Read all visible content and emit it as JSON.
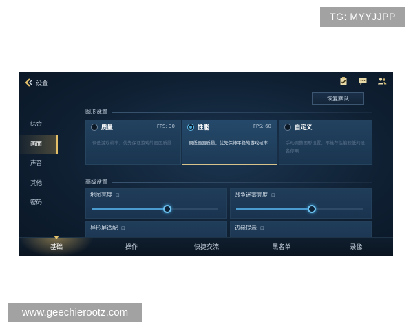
{
  "watermarks": {
    "tag": "TG: MYYJJPP",
    "url": "www.geechierootz.com"
  },
  "header": {
    "title": "设置",
    "restore_label": "恢复默认",
    "icons": [
      "back-arrow-icon",
      "clipboard-check-icon",
      "chat-icon",
      "friends-icon"
    ]
  },
  "sidebar": {
    "items": [
      {
        "label": "综合",
        "active": false
      },
      {
        "label": "画面",
        "active": true
      },
      {
        "label": "声音",
        "active": false
      },
      {
        "label": "其他",
        "active": false
      },
      {
        "label": "密码",
        "active": false
      }
    ]
  },
  "graphics": {
    "section_title": "图形设置",
    "modes": [
      {
        "name": "质量",
        "fps": "FPS: 30",
        "desc": "调低游戏帧率，优先保证游戏的画面质量",
        "selected": false
      },
      {
        "name": "性能",
        "fps": "FPS: 60",
        "desc": "调低画面质量，优先保持平稳的游戏帧率",
        "selected": true
      },
      {
        "name": "自定义",
        "fps": "",
        "desc": "手动调整图形设置，不推荐性能较低的设备使用",
        "selected": false
      }
    ]
  },
  "advanced": {
    "section_title": "高级设置",
    "info_glyph": "⊟",
    "items": [
      {
        "label": "地图亮度",
        "value": 0.6
      },
      {
        "label": "战争迷雾亮度",
        "value": 0.6
      },
      {
        "label": "异形屏适配"
      },
      {
        "label": "边缘提示"
      }
    ]
  },
  "bottom_tabs": [
    {
      "label": "基础",
      "active": true
    },
    {
      "label": "操作",
      "active": false
    },
    {
      "label": "快捷交流",
      "active": false
    },
    {
      "label": "黑名单",
      "active": false
    },
    {
      "label": "录像",
      "active": false
    }
  ],
  "colors": {
    "accent_gold": "#e3bf6a",
    "accent_blue": "#4c9bcf",
    "background": "#0f2033"
  }
}
